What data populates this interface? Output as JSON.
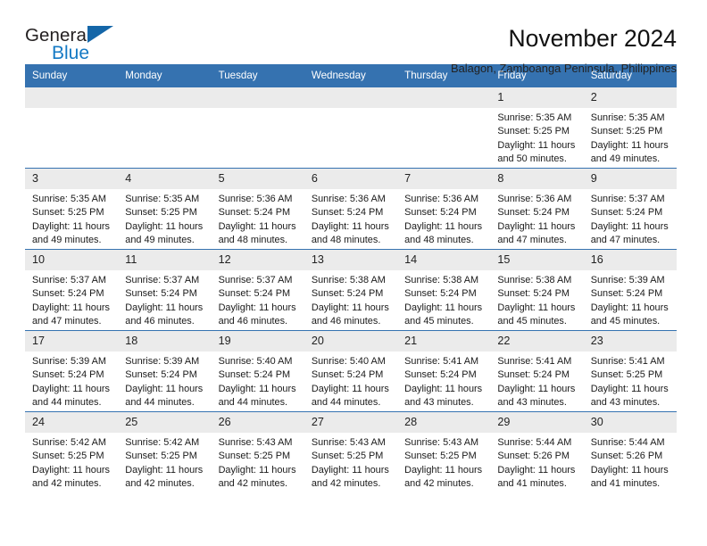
{
  "logo": {
    "word1": "General",
    "word2": "Blue",
    "triangle_color": "#1466a8",
    "blue_color": "#1479c4"
  },
  "header": {
    "title": "November 2024",
    "location": "Balagon, Zamboanga Peninsula, Philippines"
  },
  "theme": {
    "header_blue": "#3572b0",
    "daynum_band": "#ebebeb",
    "row_rule": "#3572b0"
  },
  "columns": [
    "Sunday",
    "Monday",
    "Tuesday",
    "Wednesday",
    "Thursday",
    "Friday",
    "Saturday"
  ],
  "weeks": [
    [
      {
        "day": "",
        "empty": true
      },
      {
        "day": "",
        "empty": true
      },
      {
        "day": "",
        "empty": true
      },
      {
        "day": "",
        "empty": true
      },
      {
        "day": "",
        "empty": true
      },
      {
        "day": "1",
        "sunrise": "Sunrise: 5:35 AM",
        "sunset": "Sunset: 5:25 PM",
        "daylight1": "Daylight: 11 hours",
        "daylight2": "and 50 minutes."
      },
      {
        "day": "2",
        "sunrise": "Sunrise: 5:35 AM",
        "sunset": "Sunset: 5:25 PM",
        "daylight1": "Daylight: 11 hours",
        "daylight2": "and 49 minutes."
      }
    ],
    [
      {
        "day": "3",
        "sunrise": "Sunrise: 5:35 AM",
        "sunset": "Sunset: 5:25 PM",
        "daylight1": "Daylight: 11 hours",
        "daylight2": "and 49 minutes."
      },
      {
        "day": "4",
        "sunrise": "Sunrise: 5:35 AM",
        "sunset": "Sunset: 5:25 PM",
        "daylight1": "Daylight: 11 hours",
        "daylight2": "and 49 minutes."
      },
      {
        "day": "5",
        "sunrise": "Sunrise: 5:36 AM",
        "sunset": "Sunset: 5:24 PM",
        "daylight1": "Daylight: 11 hours",
        "daylight2": "and 48 minutes."
      },
      {
        "day": "6",
        "sunrise": "Sunrise: 5:36 AM",
        "sunset": "Sunset: 5:24 PM",
        "daylight1": "Daylight: 11 hours",
        "daylight2": "and 48 minutes."
      },
      {
        "day": "7",
        "sunrise": "Sunrise: 5:36 AM",
        "sunset": "Sunset: 5:24 PM",
        "daylight1": "Daylight: 11 hours",
        "daylight2": "and 48 minutes."
      },
      {
        "day": "8",
        "sunrise": "Sunrise: 5:36 AM",
        "sunset": "Sunset: 5:24 PM",
        "daylight1": "Daylight: 11 hours",
        "daylight2": "and 47 minutes."
      },
      {
        "day": "9",
        "sunrise": "Sunrise: 5:37 AM",
        "sunset": "Sunset: 5:24 PM",
        "daylight1": "Daylight: 11 hours",
        "daylight2": "and 47 minutes."
      }
    ],
    [
      {
        "day": "10",
        "sunrise": "Sunrise: 5:37 AM",
        "sunset": "Sunset: 5:24 PM",
        "daylight1": "Daylight: 11 hours",
        "daylight2": "and 47 minutes."
      },
      {
        "day": "11",
        "sunrise": "Sunrise: 5:37 AM",
        "sunset": "Sunset: 5:24 PM",
        "daylight1": "Daylight: 11 hours",
        "daylight2": "and 46 minutes."
      },
      {
        "day": "12",
        "sunrise": "Sunrise: 5:37 AM",
        "sunset": "Sunset: 5:24 PM",
        "daylight1": "Daylight: 11 hours",
        "daylight2": "and 46 minutes."
      },
      {
        "day": "13",
        "sunrise": "Sunrise: 5:38 AM",
        "sunset": "Sunset: 5:24 PM",
        "daylight1": "Daylight: 11 hours",
        "daylight2": "and 46 minutes."
      },
      {
        "day": "14",
        "sunrise": "Sunrise: 5:38 AM",
        "sunset": "Sunset: 5:24 PM",
        "daylight1": "Daylight: 11 hours",
        "daylight2": "and 45 minutes."
      },
      {
        "day": "15",
        "sunrise": "Sunrise: 5:38 AM",
        "sunset": "Sunset: 5:24 PM",
        "daylight1": "Daylight: 11 hours",
        "daylight2": "and 45 minutes."
      },
      {
        "day": "16",
        "sunrise": "Sunrise: 5:39 AM",
        "sunset": "Sunset: 5:24 PM",
        "daylight1": "Daylight: 11 hours",
        "daylight2": "and 45 minutes."
      }
    ],
    [
      {
        "day": "17",
        "sunrise": "Sunrise: 5:39 AM",
        "sunset": "Sunset: 5:24 PM",
        "daylight1": "Daylight: 11 hours",
        "daylight2": "and 44 minutes."
      },
      {
        "day": "18",
        "sunrise": "Sunrise: 5:39 AM",
        "sunset": "Sunset: 5:24 PM",
        "daylight1": "Daylight: 11 hours",
        "daylight2": "and 44 minutes."
      },
      {
        "day": "19",
        "sunrise": "Sunrise: 5:40 AM",
        "sunset": "Sunset: 5:24 PM",
        "daylight1": "Daylight: 11 hours",
        "daylight2": "and 44 minutes."
      },
      {
        "day": "20",
        "sunrise": "Sunrise: 5:40 AM",
        "sunset": "Sunset: 5:24 PM",
        "daylight1": "Daylight: 11 hours",
        "daylight2": "and 44 minutes."
      },
      {
        "day": "21",
        "sunrise": "Sunrise: 5:41 AM",
        "sunset": "Sunset: 5:24 PM",
        "daylight1": "Daylight: 11 hours",
        "daylight2": "and 43 minutes."
      },
      {
        "day": "22",
        "sunrise": "Sunrise: 5:41 AM",
        "sunset": "Sunset: 5:24 PM",
        "daylight1": "Daylight: 11 hours",
        "daylight2": "and 43 minutes."
      },
      {
        "day": "23",
        "sunrise": "Sunrise: 5:41 AM",
        "sunset": "Sunset: 5:25 PM",
        "daylight1": "Daylight: 11 hours",
        "daylight2": "and 43 minutes."
      }
    ],
    [
      {
        "day": "24",
        "sunrise": "Sunrise: 5:42 AM",
        "sunset": "Sunset: 5:25 PM",
        "daylight1": "Daylight: 11 hours",
        "daylight2": "and 42 minutes."
      },
      {
        "day": "25",
        "sunrise": "Sunrise: 5:42 AM",
        "sunset": "Sunset: 5:25 PM",
        "daylight1": "Daylight: 11 hours",
        "daylight2": "and 42 minutes."
      },
      {
        "day": "26",
        "sunrise": "Sunrise: 5:43 AM",
        "sunset": "Sunset: 5:25 PM",
        "daylight1": "Daylight: 11 hours",
        "daylight2": "and 42 minutes."
      },
      {
        "day": "27",
        "sunrise": "Sunrise: 5:43 AM",
        "sunset": "Sunset: 5:25 PM",
        "daylight1": "Daylight: 11 hours",
        "daylight2": "and 42 minutes."
      },
      {
        "day": "28",
        "sunrise": "Sunrise: 5:43 AM",
        "sunset": "Sunset: 5:25 PM",
        "daylight1": "Daylight: 11 hours",
        "daylight2": "and 42 minutes."
      },
      {
        "day": "29",
        "sunrise": "Sunrise: 5:44 AM",
        "sunset": "Sunset: 5:26 PM",
        "daylight1": "Daylight: 11 hours",
        "daylight2": "and 41 minutes."
      },
      {
        "day": "30",
        "sunrise": "Sunrise: 5:44 AM",
        "sunset": "Sunset: 5:26 PM",
        "daylight1": "Daylight: 11 hours",
        "daylight2": "and 41 minutes."
      }
    ]
  ]
}
